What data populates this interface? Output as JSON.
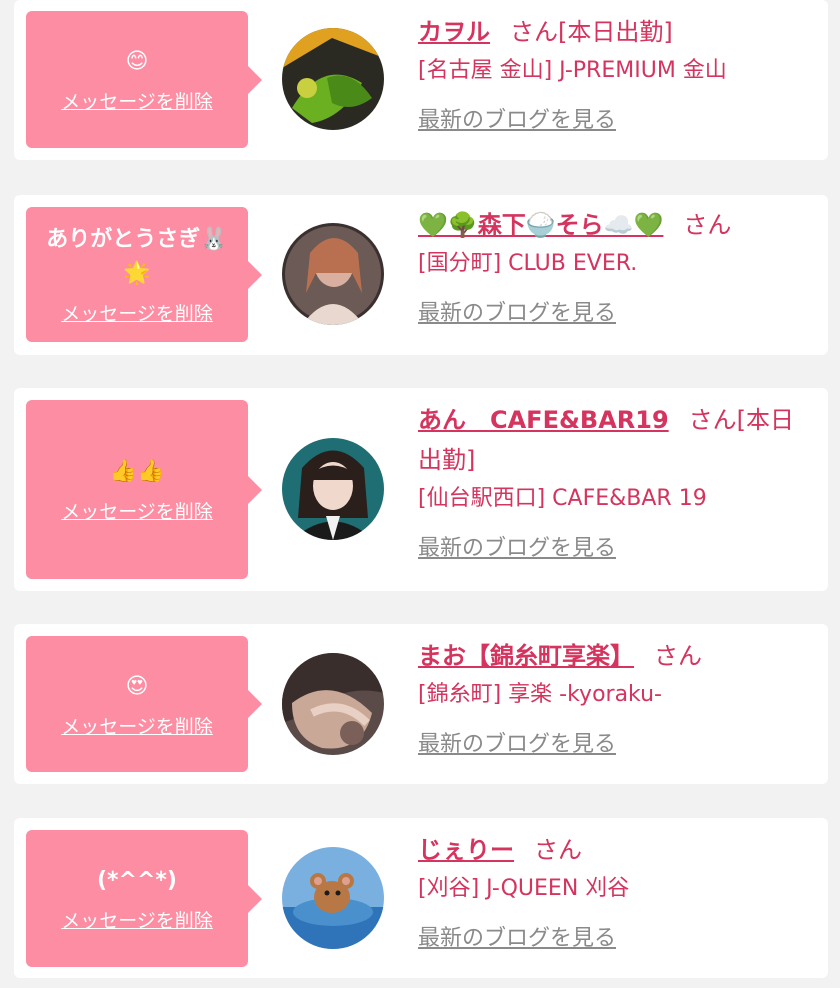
{
  "cards": [
    {
      "message": "😊",
      "delete_label": "メッセージを削除",
      "name": "カヲル",
      "honorific": "さん[本日出勤]",
      "area_shop": "[名古屋 金山] J-PREMIUM 金山",
      "blog_label": "最新のブログを見る",
      "avatar_icon": "avatar-photo-icon"
    },
    {
      "message": "ありがとうさぎ🐰🌟",
      "delete_label": "メッセージを削除",
      "name": "💚🌳森下🍚そら☁️💚",
      "honorific": "さん",
      "area_shop": "[国分町] CLUB EVER.",
      "blog_label": "最新のブログを見る",
      "avatar_icon": "avatar-photo-icon"
    },
    {
      "message": "👍👍",
      "delete_label": "メッセージを削除",
      "name": "あん　CAFE&BAR19",
      "honorific": "さん[本日出勤]",
      "area_shop": "[仙台駅西口] CAFE&BAR 19",
      "blog_label": "最新のブログを見る",
      "avatar_icon": "avatar-photo-icon"
    },
    {
      "message": "😍",
      "delete_label": "メッセージを削除",
      "name": "まお【錦糸町享楽】",
      "honorific": "さん",
      "area_shop": "[錦糸町] 享楽 -kyoraku-",
      "blog_label": "最新のブログを見る",
      "avatar_icon": "avatar-photo-icon"
    },
    {
      "message": "(*^^*)",
      "delete_label": "メッセージを削除",
      "name": "じぇりー",
      "honorific": "さん",
      "area_shop": "[刈谷] J-QUEEN 刈谷",
      "blog_label": "最新のブログを見る",
      "avatar_icon": "avatar-photo-icon"
    }
  ],
  "colors": {
    "bubble": "#fd8da2",
    "accent_text": "#d4345e",
    "link_gray": "#8a8a8a",
    "background": "#f2f2f2"
  }
}
